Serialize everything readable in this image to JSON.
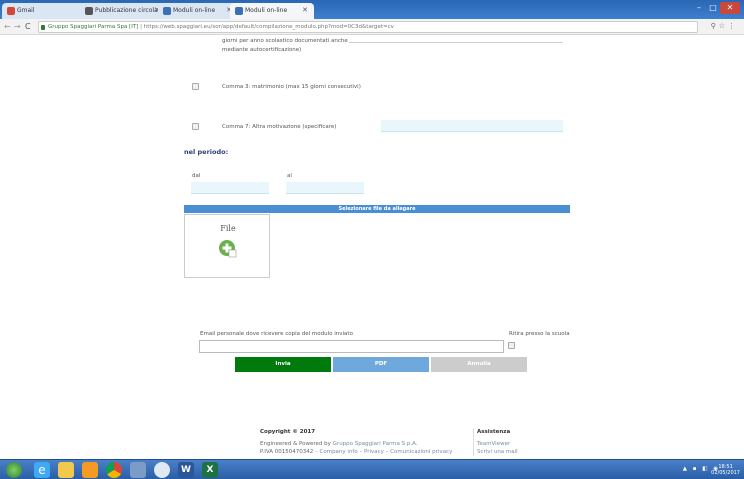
{
  "browser": {
    "tabs": [
      {
        "label": "Gmail",
        "favicon_color": "#d44638",
        "active": false
      },
      {
        "label": "Pubblicazione circolari",
        "favicon_color": "#555555",
        "active": false
      },
      {
        "label": "Moduli on-line",
        "favicon_color": "#3b6fb6",
        "active": false
      },
      {
        "label": "Moduli on-line",
        "favicon_color": "#3b6fb6",
        "active": true
      }
    ],
    "site_name": "Gruppo Spaggiari Parma Spa [IT]",
    "url": "https://web.spaggiari.eu/sor/app/default/compilazione_modulo.php?mod=0C3d&target=cv"
  },
  "form": {
    "partial_text_line1": "giorni per anno scolastico documentati anche",
    "partial_text_line2": "mediante autocertificazione)",
    "option_matrimonio": "Comma 3: matrimonio (max 15 giorni consecutivi)",
    "option_altra": "Comma 7: Altra motivazione (specificare)",
    "period_heading": "nel periodo:",
    "from_label": "dal",
    "to_label": "al",
    "attachments_heading": "Selezionare file da allegare",
    "file_label": "File",
    "email_label": "Email personale dove ricevere copia del modulo inviato",
    "ritira_label": "Ritira presso la scuola",
    "buttons": {
      "send": "Invia",
      "pdf": "PDF",
      "cancel": "Annulla"
    },
    "button_colors": {
      "send": "#007a0c",
      "pdf": "#6fa8dc",
      "cancel": "#cccccc"
    }
  },
  "footer": {
    "copyright": "Copyright © 2017",
    "powered_prefix": "Engineered & Powered by",
    "powered_company": "Gruppo Spaggiari Parma S.p.A.",
    "piva": "P.IVA 00150470342",
    "links": [
      "Company info",
      "Privacy",
      "Comunicazioni privacy"
    ],
    "assistenza_heading": "Assistenza",
    "assistenza_links": [
      "TeamViewer",
      "Scrivi una mail"
    ]
  },
  "taskbar": {
    "apps": [
      "start",
      "internet-explorer",
      "file-explorer",
      "media-player",
      "chrome",
      "search",
      "chrome-alt",
      "word",
      "excel"
    ],
    "time": "18:51",
    "date": "02/05/2017"
  }
}
